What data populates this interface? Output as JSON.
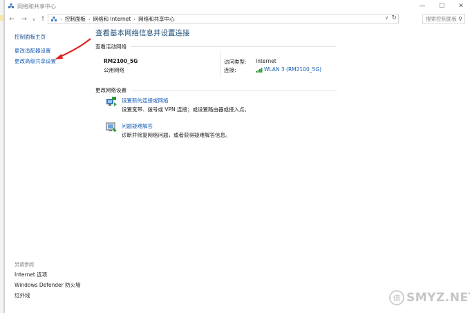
{
  "window": {
    "title": "网络和共享中心",
    "controls": {
      "minimize": "—",
      "maximize": "☐",
      "close": "✕"
    }
  },
  "address": {
    "breadcrumbs": [
      "控制面板",
      "网络和 Internet",
      "网络和共享中心"
    ],
    "separator": "›",
    "search_placeholder": "搜索控制面板"
  },
  "nav": {
    "back": "←",
    "forward": "→",
    "dropdown": "∨",
    "up": "↑"
  },
  "leftpane": {
    "home": "控制面板主页",
    "adapter": "更改适配器设置",
    "sharing": "更改高级共享设置"
  },
  "see_also": {
    "heading": "另请参阅",
    "links": [
      "Internet 选项",
      "Windows Defender 防火墙",
      "红外线"
    ]
  },
  "main": {
    "title": "查看基本网络信息并设置连接",
    "active_networks_label": "查看活动网络",
    "network": {
      "name": "RM2100_5G",
      "type": "公用网络",
      "access_type_label": "访问类型:",
      "access_type_value": "Internet",
      "connection_label": "连接:",
      "connection_value": "WLAN 3 (RM2100_5G)"
    },
    "change_settings_label": "更改网络设置",
    "tasks": [
      {
        "title": "设置新的连接或网络",
        "desc": "设置宽带、拨号或 VPN 连接；或设置路由器或接入点。"
      },
      {
        "title": "问题疑难解答",
        "desc": "诊断并修复网络问题，或者获得疑难解答信息。"
      }
    ]
  },
  "watermark": {
    "text": "SMYZ.NET",
    "logo": "值"
  },
  "colors": {
    "link": "#1a5fb4",
    "title": "#1f4e79",
    "arrow": "#e02020"
  }
}
